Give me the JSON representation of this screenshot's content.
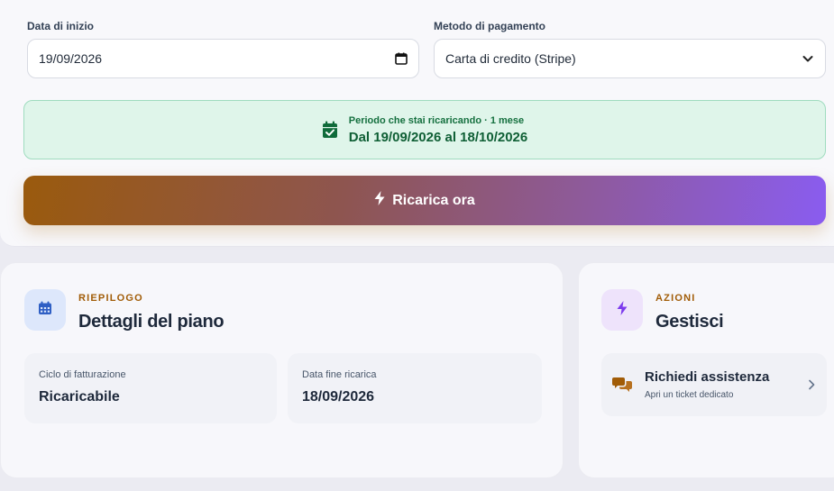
{
  "form": {
    "start_date_label": "Data di inizio",
    "start_date_value": "19/09/2026",
    "payment_label": "Metodo di pagamento",
    "payment_value": "Carta di credito (Stripe)"
  },
  "period": {
    "label": "Periodo che stai ricaricando · 1 mese",
    "range": "Dal 19/09/2026 al 18/10/2026"
  },
  "recharge_button": {
    "label": "Ricarica ora"
  },
  "summary": {
    "eyebrow": "RIEPILOGO",
    "title": "Dettagli del piano",
    "tiles": [
      {
        "label": "Ciclo di fatturazione",
        "value": "Ricaricabile"
      },
      {
        "label": "Data fine ricarica",
        "value": "18/09/2026"
      }
    ]
  },
  "actions": {
    "eyebrow": "AZIONI",
    "title": "Gestisci",
    "support": {
      "title": "Richiedi assistenza",
      "subtitle": "Apri un ticket dedicato"
    }
  },
  "colors": {
    "accent_amber": "#a15c07",
    "success_green": "#15703f",
    "gradient_start": "#9a5a0d",
    "gradient_end": "#8a5cf0"
  },
  "icons": {
    "date_field": "calendar-icon",
    "select": "chevron-down-icon",
    "period": "calendar-check-icon",
    "recharge": "lightning-bolt-icon",
    "summary": "calendar-grid-icon",
    "actions": "lightning-bolt-icon",
    "support": "chat-bubbles-icon",
    "support_chevron": "chevron-right-icon"
  }
}
